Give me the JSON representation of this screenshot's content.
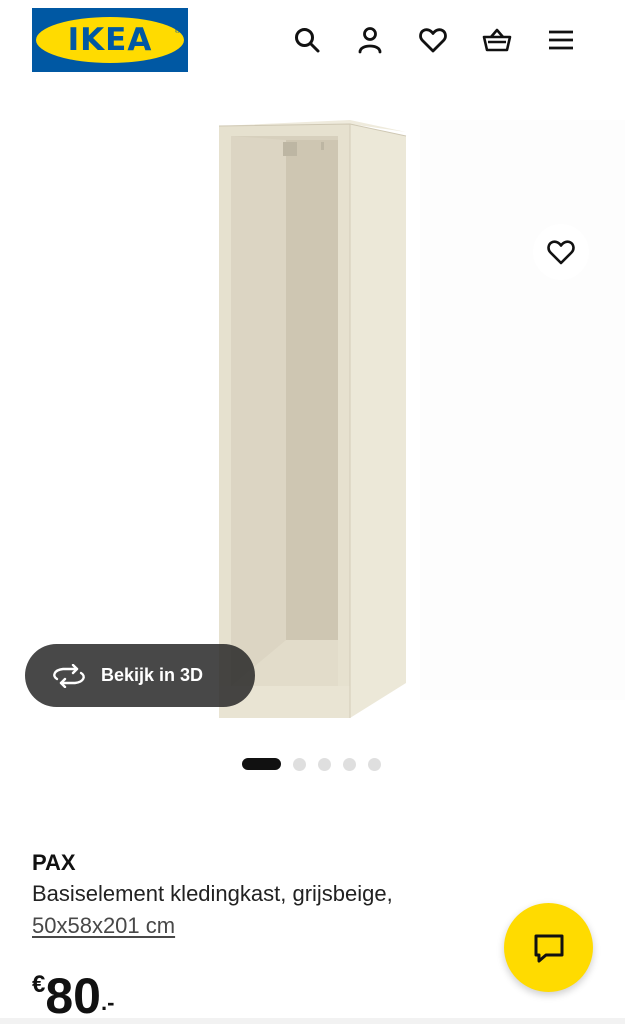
{
  "header": {
    "logo_text": "IKEA",
    "logo_mark": "®",
    "icons": [
      "search-icon",
      "account-icon",
      "heart-icon",
      "basket-icon",
      "menu-icon"
    ]
  },
  "gallery": {
    "button_3d_label": "Bekijk in 3D",
    "icons": [
      "rotate-3d-icon",
      "heart-icon"
    ],
    "image_count": 5,
    "active_image": 1
  },
  "product": {
    "name": "PAX",
    "description": "Basiselement kledingkast, grijsbeige,",
    "dimensions": "50x58x201 cm",
    "price": {
      "currency": "€",
      "integer": "80",
      "decimal": ".-"
    }
  },
  "chat": {
    "icon": "chat-icon"
  },
  "colors": {
    "ikea_blue": "#0058a3",
    "ikea_yellow": "#ffdb00",
    "text": "#111111",
    "wardrobe": "#e4dfcc"
  }
}
